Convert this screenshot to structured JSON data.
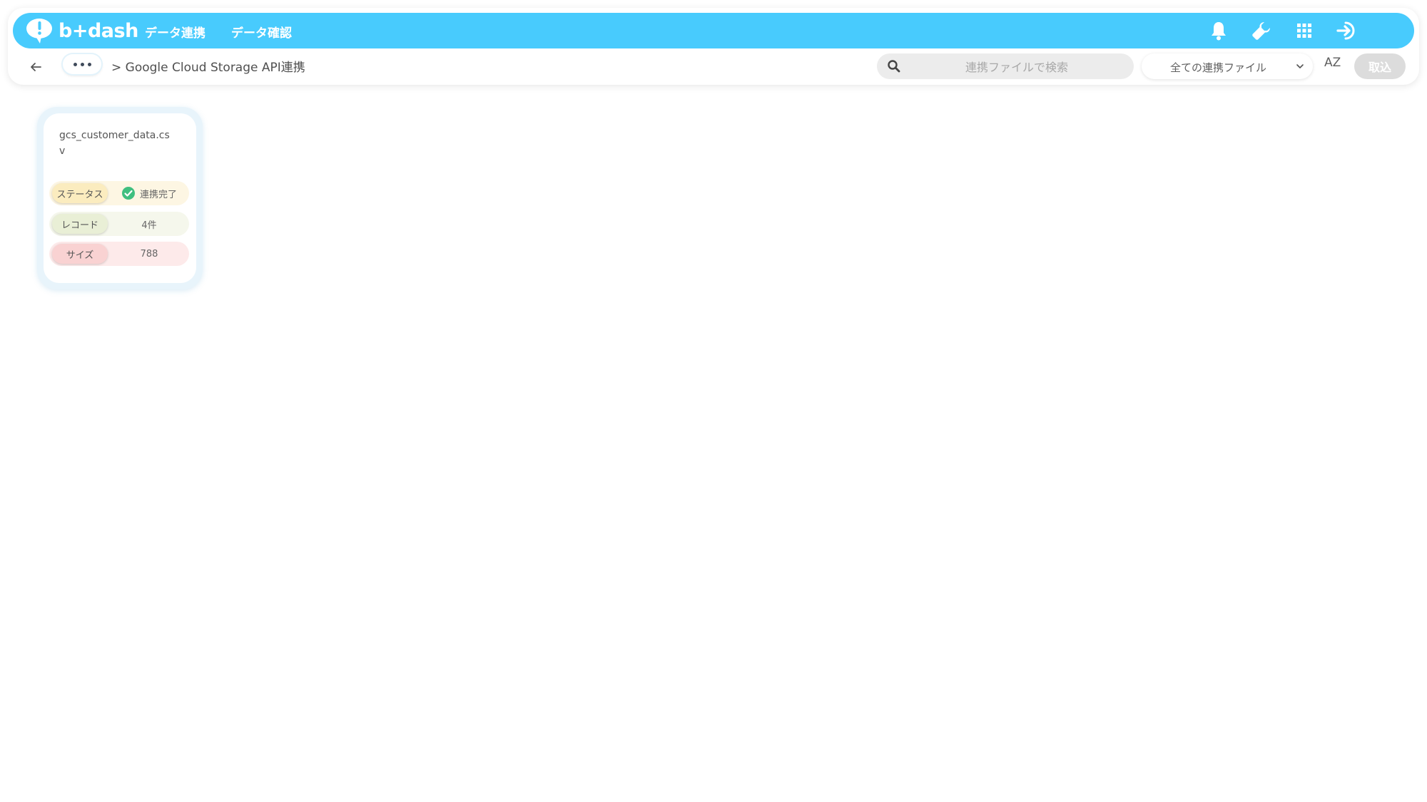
{
  "app": {
    "logo_text": "b+dash",
    "nav": [
      "データ連携",
      "データ確認"
    ],
    "icons": [
      "bell-icon",
      "wrench-icon",
      "grid-icon",
      "logout-icon"
    ]
  },
  "subbar": {
    "breadcrumb": "> Google Cloud Storage API連携",
    "search_placeholder": "連携ファイルで検索",
    "filter_selected": "全ての連携ファイル",
    "sort_label": "AZ",
    "import_label": "取込"
  },
  "cards": [
    {
      "file_name": "gcs_customer_data.csv",
      "status_label": "ステータス",
      "status_value": "連携完了",
      "record_label": "レコード",
      "record_value": "4件",
      "size_label": "サイズ",
      "size_value": "788"
    }
  ],
  "colors": {
    "header_bg": "#48cbfd",
    "status_ok": "#3fbf7f",
    "import_disabled": "#dcdcdc"
  }
}
